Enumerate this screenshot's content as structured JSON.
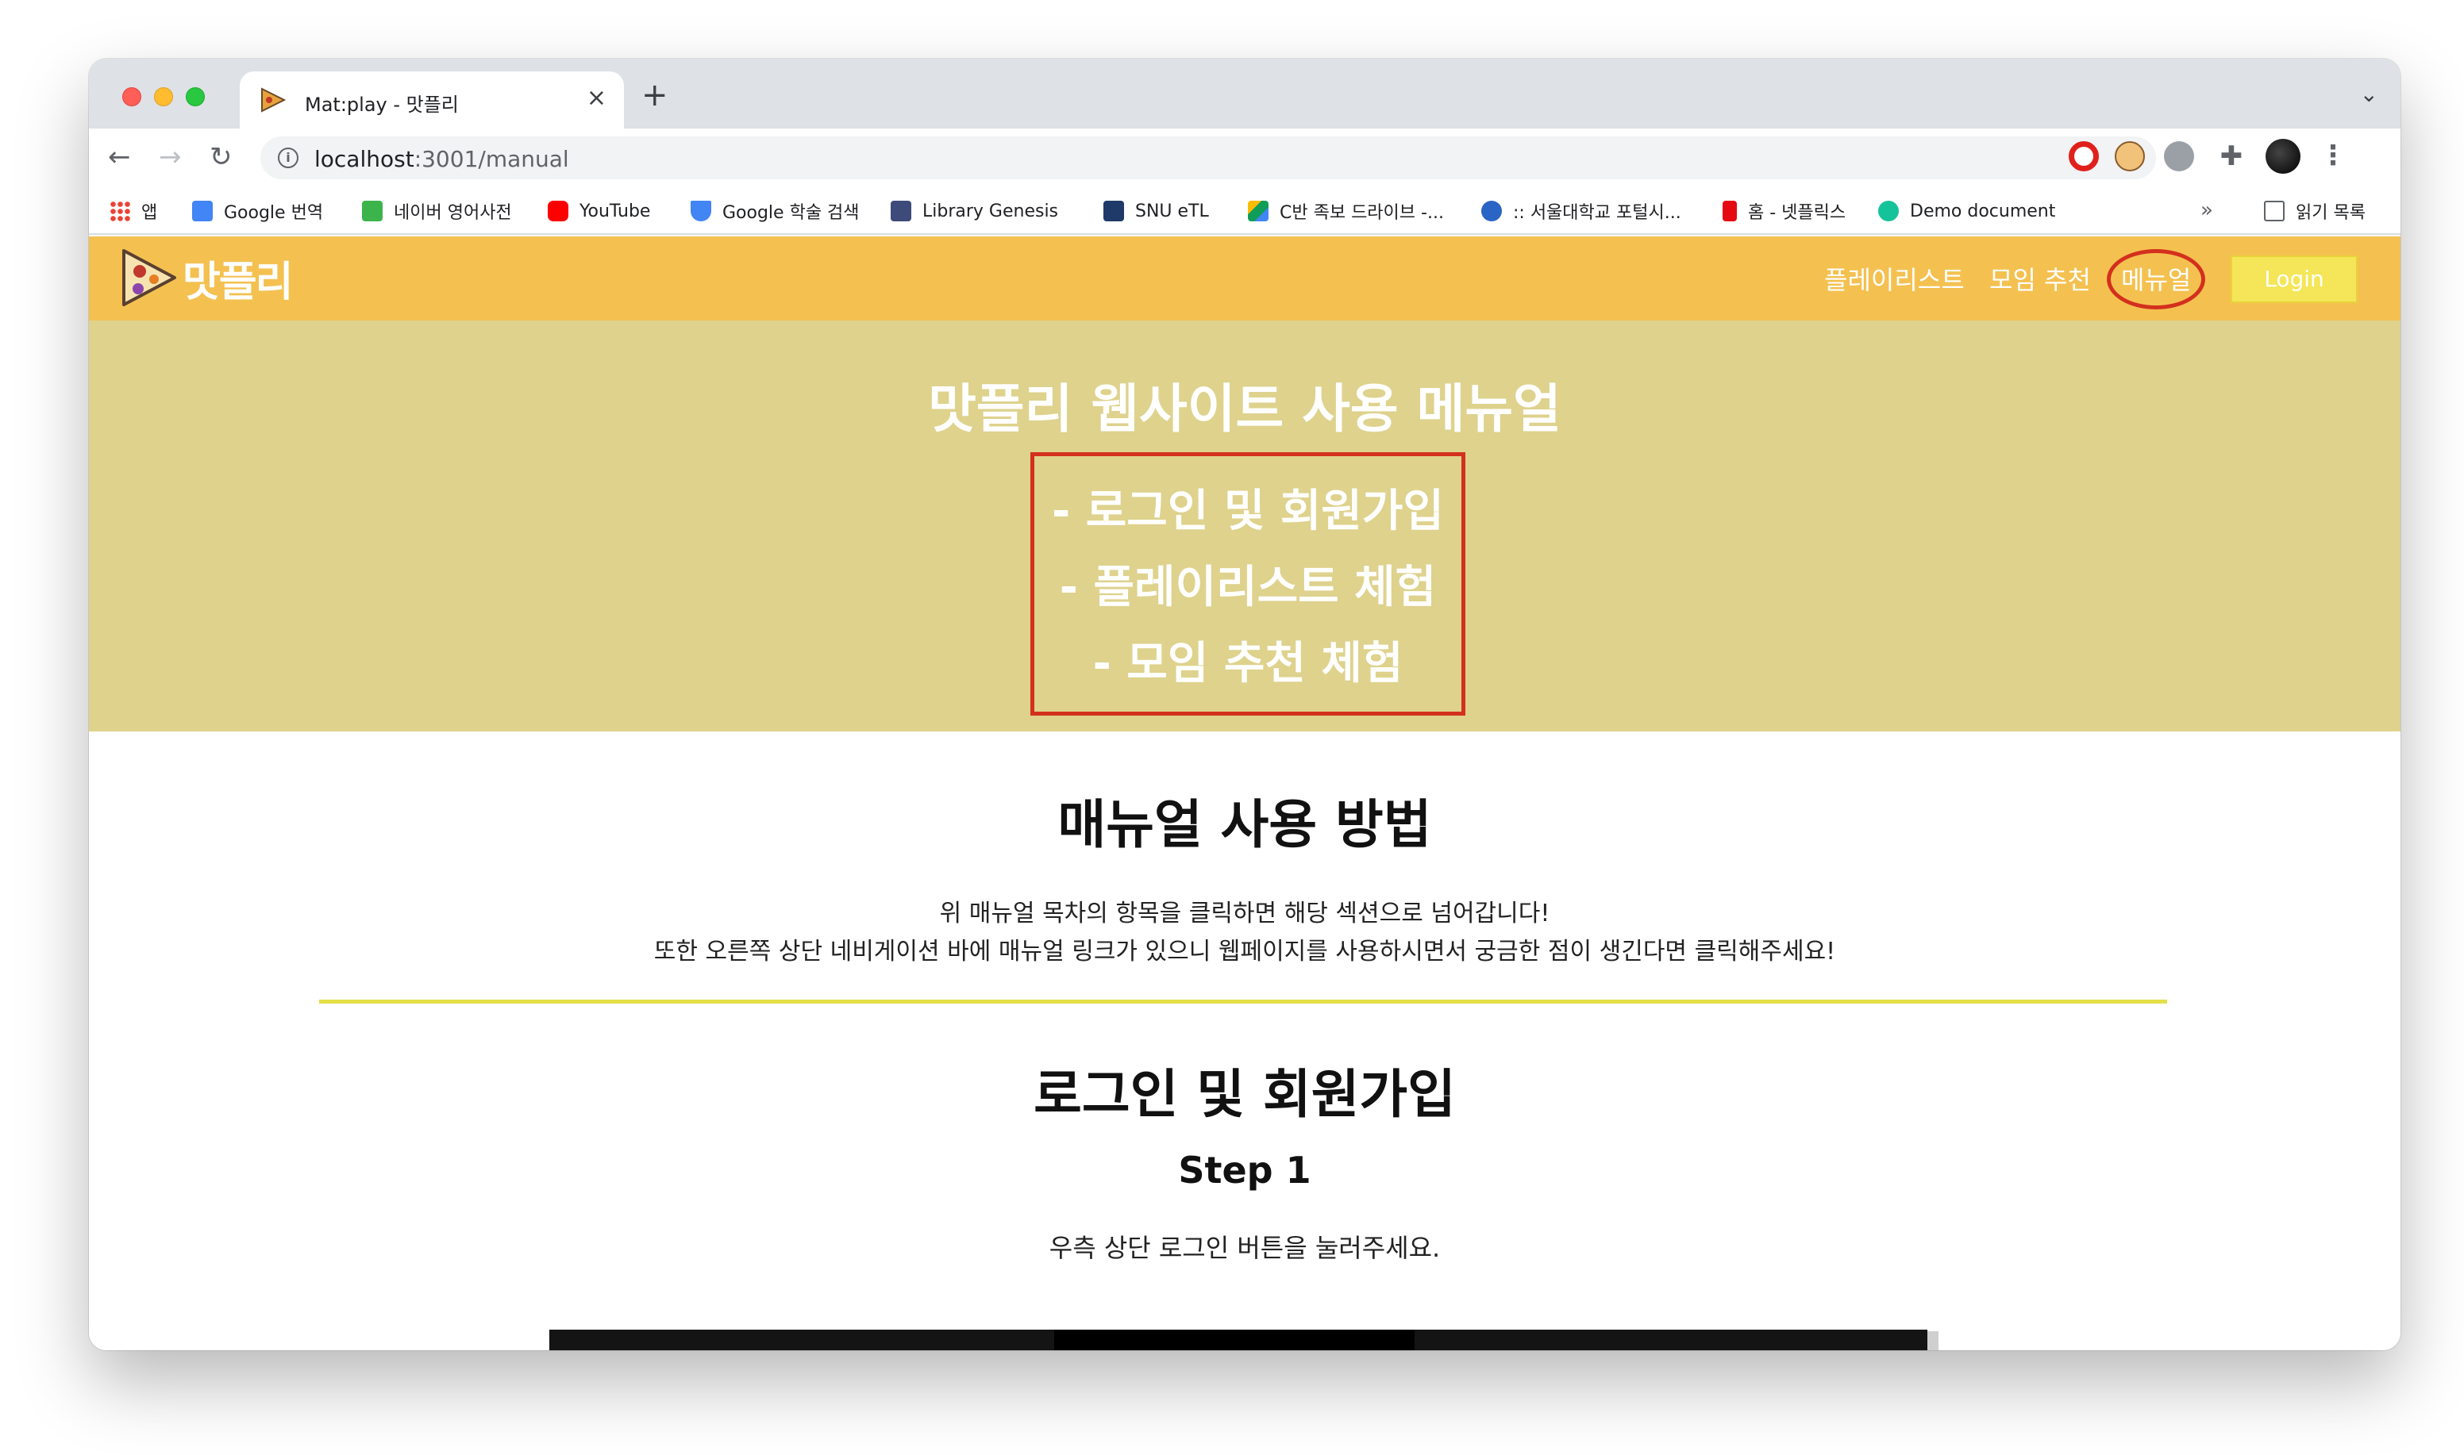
{
  "browser": {
    "tab_title": "Mat:play - 맛플리",
    "tab_close": "×",
    "new_tab": "+",
    "tab_menu": "⌄",
    "url_host": "localhost",
    "url_path": ":3001/manual",
    "info_glyph": "i",
    "nav": {
      "back": "←",
      "forward": "→",
      "reload": "↻"
    },
    "share_glyph": "⇪",
    "star_glyph": "☆",
    "puzzle_glyph": "✚",
    "kebab_glyph": "⋮"
  },
  "bookmarks": {
    "items": [
      {
        "label": "앱",
        "icon": "apps-grid-icon",
        "color": "#ea4335"
      },
      {
        "label": "Google 번역",
        "icon": "google-translate-icon",
        "color": "#4285f4"
      },
      {
        "label": "네이버 영어사전",
        "icon": "naver-dict-icon",
        "color": "#3cb44b"
      },
      {
        "label": "YouTube",
        "icon": "youtube-icon",
        "color": "#ff0000"
      },
      {
        "label": "Google 학술 검색",
        "icon": "google-scholar-icon",
        "color": "#4285f4"
      },
      {
        "label": "Library Genesis",
        "icon": "libgen-icon",
        "color": "#3d4a7a"
      },
      {
        "label": "SNU eTL",
        "icon": "snu-etl-icon",
        "color": "#1f3a68"
      },
      {
        "label": "C반 족보 드라이브 -...",
        "icon": "google-drive-icon",
        "color": "#0f9d58"
      },
      {
        "label": ":: 서울대학교 포털시...",
        "icon": "snu-portal-icon",
        "color": "#2a64c5"
      },
      {
        "label": "홈 - 넷플릭스",
        "icon": "netflix-icon",
        "color": "#e50914"
      },
      {
        "label": "Demo document",
        "icon": "grammarly-icon",
        "color": "#15c39a"
      }
    ],
    "more": "»",
    "reading_list": "읽기 목록"
  },
  "site": {
    "logo_text": "맛플리",
    "nav": {
      "playlist": "플레이리스트",
      "meeting": "모임 추천",
      "manual": "메뉴얼",
      "login": "Login"
    },
    "hero": {
      "title": "맛플리 웹사이트 사용 메뉴얼",
      "toc": [
        "- 로그인 및 회원가입",
        "- 플레이리스트 체험",
        "- 모임 추천 체험"
      ]
    },
    "content": {
      "howto_title": "매뉴얼 사용 방법",
      "howto_line1": "위 매뉴얼 목차의 항목을 클릭하면 해당 섹션으로 넘어갑니다!",
      "howto_line2": "또한 오른쪽 상단 네비게이션 바에 매뉴얼 링크가 있으니 웹페이지를 사용하시면서 궁금한 점이 생긴다면 클릭해주세요!",
      "section_title": "로그인 및 회원가입",
      "step_title": "Step 1",
      "step_desc": "우측 상단 로그인 버튼을 눌러주세요."
    }
  },
  "colors": {
    "header_bg": "#f4c150",
    "hero_bg": "#ded28d",
    "highlight_red": "#d3301e",
    "login_bg": "#f4e658",
    "divider": "#e5df48"
  }
}
